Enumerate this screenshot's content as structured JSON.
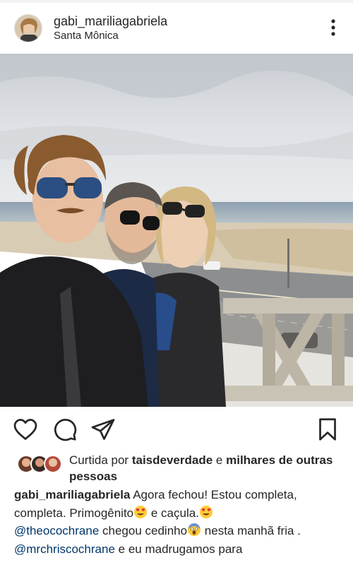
{
  "header": {
    "username": "gabi_mariliagabriela",
    "location": "Santa Mônica",
    "more_icon": "more-vertical-icon"
  },
  "actions": {
    "like_icon": "heart-icon",
    "comment_icon": "comment-icon",
    "share_icon": "send-icon",
    "save_icon": "bookmark-icon"
  },
  "likes": {
    "prefix": "Curtida por",
    "user": "taisdeverdade",
    "connector": "e",
    "others": "milhares de outras pessoas"
  },
  "caption": {
    "author": "gabi_mariliagabriela",
    "text_1": "Agora fechou! Estou completa, completa. Primogênito",
    "text_2": "e caçula.",
    "mention_1": "@theocochrane",
    "text_3": "chegou  cedinho",
    "text_4": "nesta manhã fria .",
    "mention_2": "@mrchriscochrane",
    "text_5": "e eu madrugamos para"
  },
  "colors": {
    "text": "#262626",
    "mention": "#00376b",
    "border": "#dbdbdb"
  }
}
